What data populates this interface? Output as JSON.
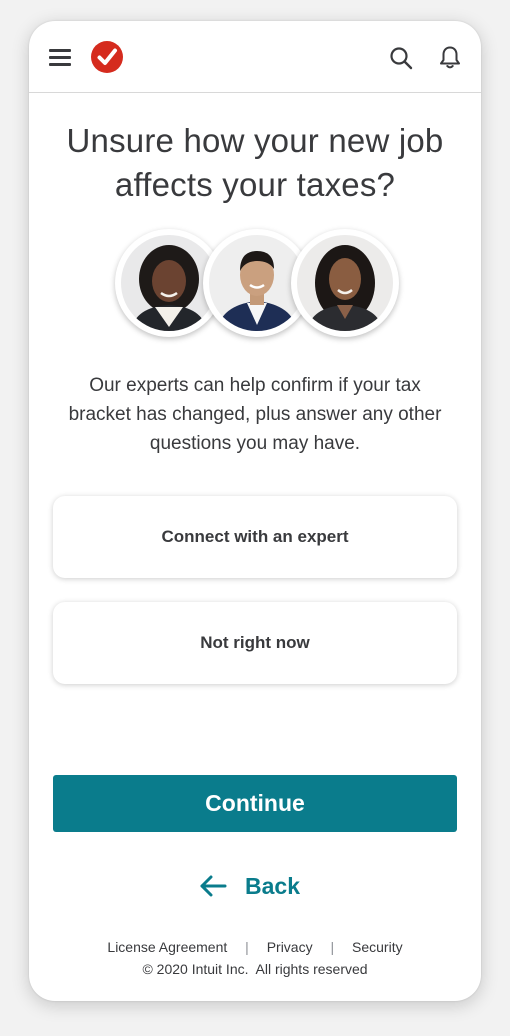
{
  "header": {
    "menu_icon": "hamburger-menu-icon",
    "logo_icon": "checkmark-logo-icon",
    "search_icon": "search-icon",
    "notifications_icon": "bell-icon"
  },
  "main": {
    "title_line1": "Unsure how your new job",
    "title_line2": "affects your taxes?",
    "description_line1": "Our experts can help confirm if your tax",
    "description_line2": "bracket has changed, plus answer any other",
    "description_line3": "questions you may have.",
    "options": [
      {
        "label": "Connect with an expert"
      },
      {
        "label": "Not right now"
      }
    ]
  },
  "actions": {
    "continue_label": "Continue",
    "back_label": "Back"
  },
  "footer": {
    "links": [
      "License Agreement",
      "Privacy",
      "Security"
    ],
    "separator": "|",
    "copyright": "© 2020 Intuit Inc.  All rights reserved"
  },
  "colors": {
    "accent": "#0a7c8c",
    "brand_red": "#d52b1e",
    "text": "#393a3d"
  }
}
